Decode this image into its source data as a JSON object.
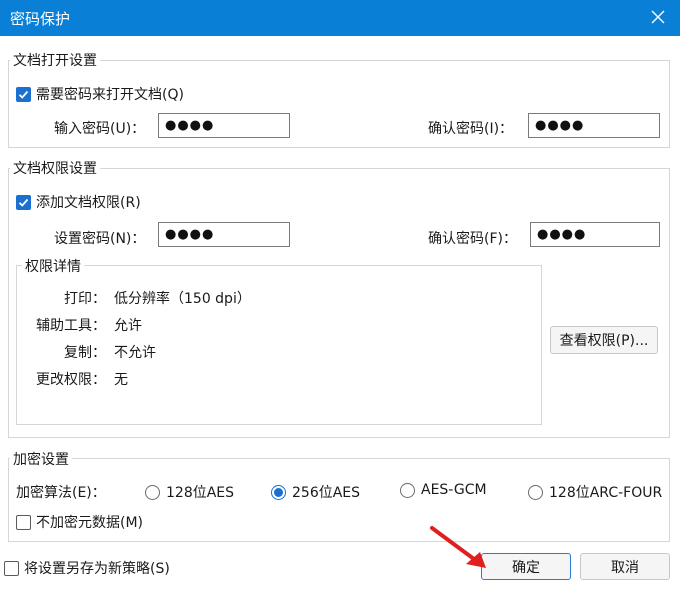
{
  "window": {
    "title": "密码保护"
  },
  "open_settings": {
    "group_title": "文档打开设置",
    "require_password_label": "需要密码来打开文档(Q)",
    "require_password_checked": true,
    "enter_password_label": "输入密码(U)：",
    "enter_password_value": "●●●●",
    "confirm_password_label": "确认密码(I)：",
    "confirm_password_value": "●●●●"
  },
  "permission_settings": {
    "group_title": "文档权限设置",
    "add_permission_label": "添加文档权限(R)",
    "add_permission_checked": true,
    "set_password_label": "设置密码(N)：",
    "set_password_value": "●●●●",
    "confirm_password_label": "确认密码(F)：",
    "confirm_password_value": "●●●●",
    "details": {
      "title": "权限详情",
      "items": [
        {
          "key": "打印：",
          "value": "低分辨率（150 dpi）"
        },
        {
          "key": "辅助工具：",
          "value": "允许"
        },
        {
          "key": "复制：",
          "value": "不允许"
        },
        {
          "key": "更改权限：",
          "value": "无"
        }
      ]
    },
    "view_permissions_button": "查看权限(P)..."
  },
  "encryption": {
    "group_title": "加密设置",
    "algorithm_label": "加密算法(E)：",
    "options": [
      {
        "label": "128位AES",
        "selected": false
      },
      {
        "label": "256位AES",
        "selected": true
      },
      {
        "label": "AES-GCM",
        "selected": false
      },
      {
        "label": "128位ARC-FOUR",
        "selected": false
      }
    ],
    "no_encrypt_metadata_label": "不加密元数据(M)",
    "no_encrypt_metadata_checked": false
  },
  "footer": {
    "save_as_policy_label": "将设置另存为新策略(S)",
    "save_as_policy_checked": false,
    "ok_button": "确定",
    "cancel_button": "取消"
  },
  "colors": {
    "titlebar": "#0a7fd6",
    "accent": "#1a6fcf",
    "annotation_arrow": "#e02020"
  }
}
